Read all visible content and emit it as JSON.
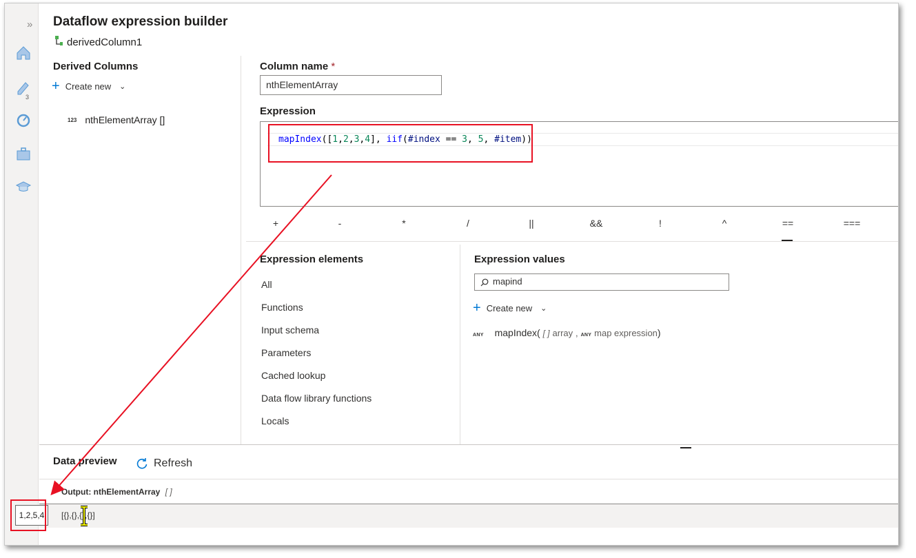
{
  "dialog": {
    "title": "Dataflow expression builder",
    "subtitle": "derivedColumn1"
  },
  "left_rail": {
    "expand_glyph": "»",
    "icons": [
      "home-icon",
      "pencil-icon",
      "monitor-icon",
      "toolbox-icon",
      "learn-icon"
    ],
    "badge": "3"
  },
  "derived_columns": {
    "heading": "Derived Columns",
    "create_new": "Create new",
    "items": [
      {
        "type_tag": "123",
        "label": "nthElementArray []"
      }
    ]
  },
  "column_name": {
    "label": "Column name",
    "required_mark": "*",
    "value": "nthElementArray"
  },
  "expression": {
    "label": "Expression",
    "tokens": [
      {
        "t": "mapIndex",
        "c": "fn"
      },
      {
        "t": "([",
        "c": "op"
      },
      {
        "t": "1",
        "c": "num"
      },
      {
        "t": ",",
        "c": "op"
      },
      {
        "t": "2",
        "c": "num"
      },
      {
        "t": ",",
        "c": "op"
      },
      {
        "t": "3",
        "c": "num"
      },
      {
        "t": ",",
        "c": "op"
      },
      {
        "t": "4",
        "c": "num"
      },
      {
        "t": "], ",
        "c": "op"
      },
      {
        "t": "iif",
        "c": "fn"
      },
      {
        "t": "(",
        "c": "op"
      },
      {
        "t": "#index",
        "c": "var"
      },
      {
        "t": " == ",
        "c": "op"
      },
      {
        "t": "3",
        "c": "num"
      },
      {
        "t": ", ",
        "c": "op"
      },
      {
        "t": "5",
        "c": "num"
      },
      {
        "t": ", ",
        "c": "op"
      },
      {
        "t": "#item",
        "c": "var"
      },
      {
        "t": "))",
        "c": "op"
      }
    ]
  },
  "operators": [
    "+",
    "-",
    "*",
    "/",
    "||",
    "&&",
    "!",
    "^",
    "==",
    "==="
  ],
  "expression_elements": {
    "heading": "Expression elements",
    "items": [
      "All",
      "Functions",
      "Input schema",
      "Parameters",
      "Cached lookup",
      "Data flow library functions",
      "Locals"
    ]
  },
  "expression_values": {
    "heading": "Expression values",
    "search_value": "mapind",
    "create_new": "Create new",
    "function": {
      "return_tag": "ANY",
      "name": "mapIndex(",
      "p1_type": "[ ]",
      "p1_name": "array",
      "sep": ",",
      "p2_tag": "ANY",
      "p2_name": "map expression",
      "close": ")"
    }
  },
  "data_preview": {
    "heading": "Data preview",
    "refresh": "Refresh",
    "output_label": "Output: nthElementArray",
    "output_type": "[ ]",
    "row_value": "[{},{},{},{}]"
  },
  "callout": {
    "value": "1,2,5,4"
  },
  "colors": {
    "accent": "#0078d4",
    "highlight": "#e81123"
  }
}
